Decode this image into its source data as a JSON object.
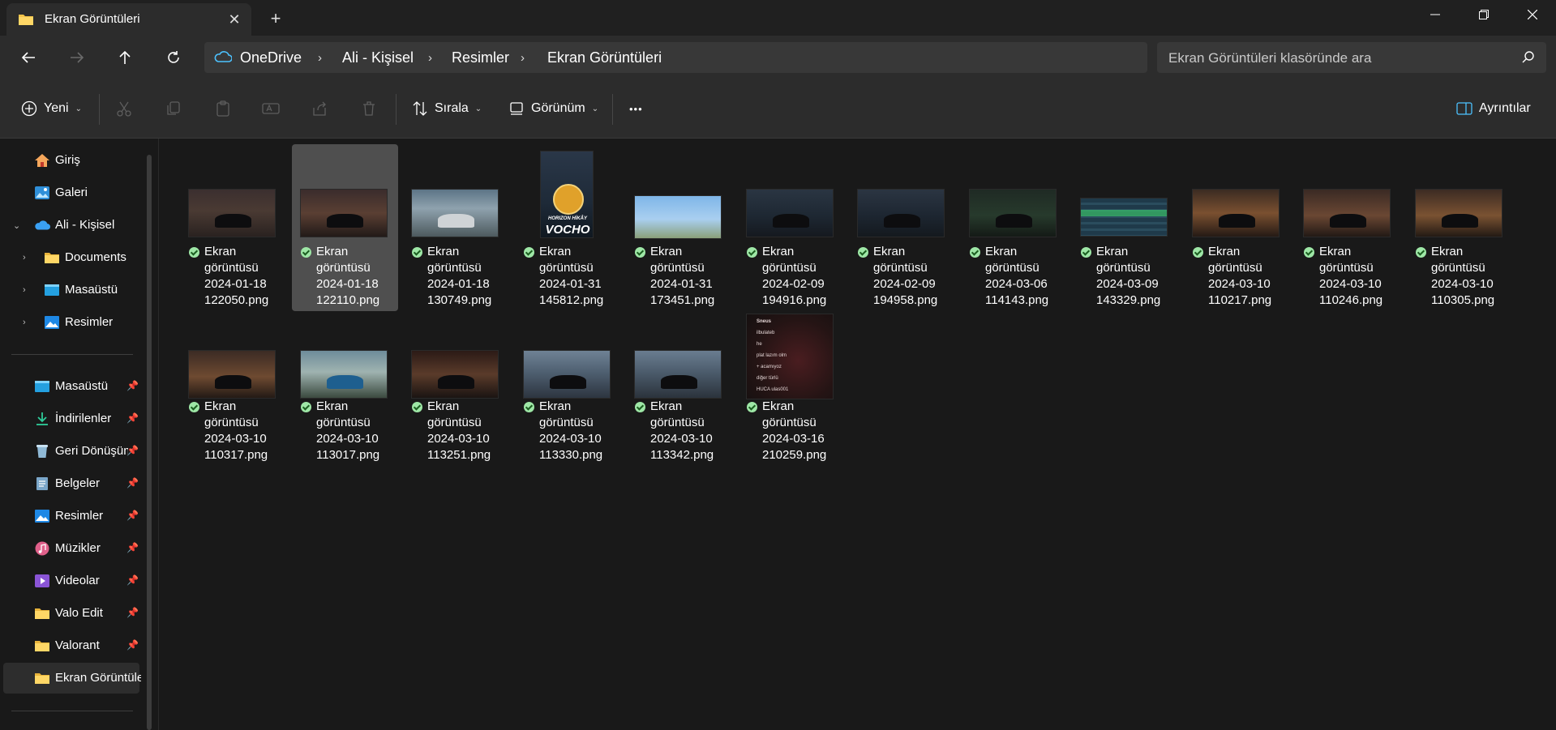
{
  "window": {
    "tab_title": "Ekran Görüntüleri",
    "tab_close": "✕",
    "new_tab": "+"
  },
  "address": {
    "breadcrumbs": [
      "OneDrive",
      "Ali - Kişisel",
      "Resimler",
      "Ekran Görüntüleri"
    ],
    "separator": "›"
  },
  "search": {
    "placeholder": "Ekran Görüntüleri klasöründe ara"
  },
  "toolbar": {
    "new_label": "Yeni",
    "sort_label": "Sırala",
    "view_label": "Görünüm",
    "more_label": "•••",
    "details_label": "Ayrıntılar",
    "chevron": "⌄"
  },
  "sidebar": {
    "chevron_right": "›",
    "chevron_down": "⌄",
    "pin": "📌",
    "top_items": [
      {
        "label": "Giriş",
        "icon": "home-icon"
      },
      {
        "label": "Galeri",
        "icon": "gallery-icon"
      },
      {
        "label": "Ali - Kişisel",
        "icon": "onedrive-cloud-icon"
      },
      {
        "label": "Documents",
        "icon": "folder-icon"
      },
      {
        "label": "Masaüstü",
        "icon": "desktop-icon"
      },
      {
        "label": "Resimler",
        "icon": "pictures-icon"
      }
    ],
    "quick_access": [
      {
        "label": "Masaüstü",
        "icon": "desktop-icon"
      },
      {
        "label": "İndirilenler",
        "icon": "download-icon"
      },
      {
        "label": "Geri Dönüşüm Kutusu",
        "icon": "recycle-bin-icon"
      },
      {
        "label": "Belgeler",
        "icon": "documents-icon"
      },
      {
        "label": "Resimler",
        "icon": "pictures-icon"
      },
      {
        "label": "Müzikler",
        "icon": "music-icon"
      },
      {
        "label": "Videolar",
        "icon": "videos-icon"
      },
      {
        "label": "Valo Edit",
        "icon": "folder-icon"
      },
      {
        "label": "Valorant",
        "icon": "folder-icon"
      },
      {
        "label": "Ekran Görüntüleri",
        "icon": "folder-icon"
      }
    ]
  },
  "files": [
    {
      "name": "Ekran görüntüsü 2024-01-18 122050.png"
    },
    {
      "name": "Ekran görüntüsü 2024-01-18 122110.png",
      "selected": true
    },
    {
      "name": "Ekran görüntüsü 2024-01-18 130749.png"
    },
    {
      "name": "Ekran görüntüsü 2024-01-31 145812.png",
      "thumb_text": [
        "HORIZON HİKÂY",
        "VOCHO"
      ]
    },
    {
      "name": "Ekran görüntüsü 2024-01-31 173451.png"
    },
    {
      "name": "Ekran görüntüsü 2024-02-09 194916.png"
    },
    {
      "name": "Ekran görüntüsü 2024-02-09 194958.png"
    },
    {
      "name": "Ekran görüntüsü 2024-03-06 114143.png"
    },
    {
      "name": "Ekran görüntüsü 2024-03-09 143329.png"
    },
    {
      "name": "Ekran görüntüsü 2024-03-10 110217.png"
    },
    {
      "name": "Ekran görüntüsü 2024-03-10 110246.png"
    },
    {
      "name": "Ekran görüntüsü 2024-03-10 110305.png"
    },
    {
      "name": "Ekran görüntüsü 2024-03-10 110317.png"
    },
    {
      "name": "Ekran görüntüsü 2024-03-10 113017.png"
    },
    {
      "name": "Ekran görüntüsü 2024-03-10 113251.png"
    },
    {
      "name": "Ekran görüntüsü 2024-03-10 113330.png"
    },
    {
      "name": "Ekran görüntüsü 2024-03-10 113342.png"
    },
    {
      "name": "Ekran görüntüsü 2024-03-16 210259.png",
      "thumb_text": [
        "Sneus",
        "ilbulateb",
        "he",
        "plat lazım olm",
        "+ acamıyoz",
        "diğer türlü",
        "HUCA ulas001"
      ]
    }
  ],
  "colors": {
    "background": "#191919",
    "chrome": "#2c2c2c",
    "selected": "#4f4f4f",
    "sync_ok": "#9ee7a6",
    "accent": "#4cc2ff"
  }
}
